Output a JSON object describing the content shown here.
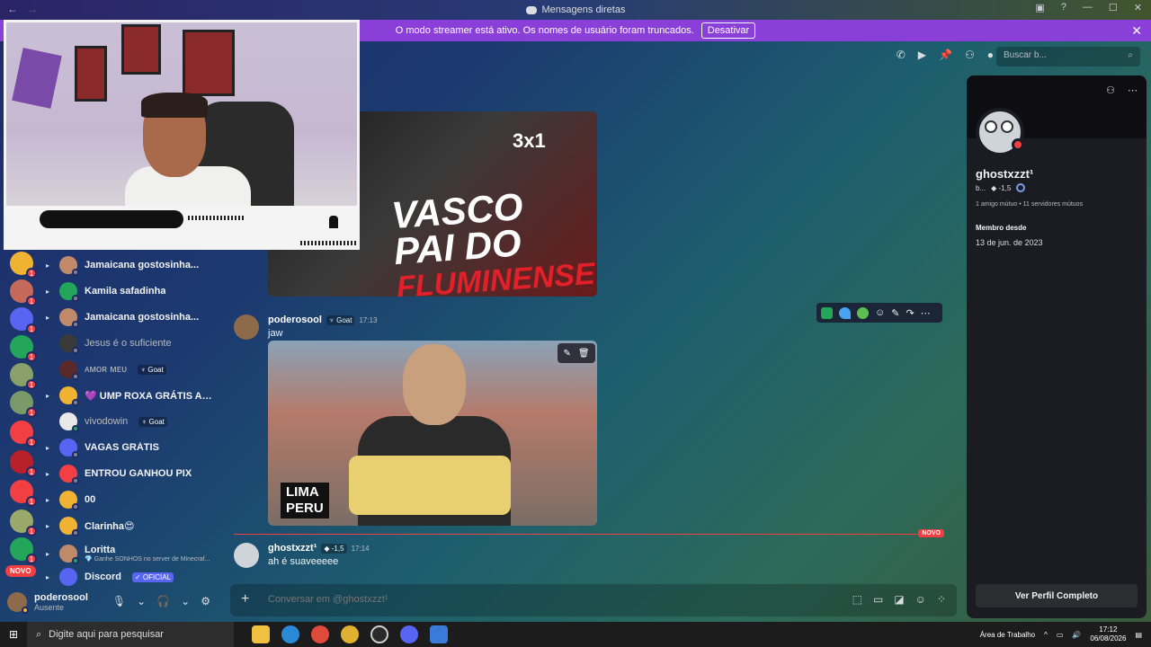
{
  "window": {
    "title": "Mensagens diretas",
    "nav_back": "←",
    "nav_forward": "→"
  },
  "banner": {
    "text": "O modo streamer está ativo. Os nomes de usuário foram truncados.",
    "button": "Desativar"
  },
  "rail": {
    "novo_label": "NOVO"
  },
  "dms": [
    {
      "name": "Jamaicana gostosinha...",
      "color": "#c08a6a"
    },
    {
      "name": "Kamila safadinha",
      "color": "#23a55a"
    },
    {
      "name": "Jamaicana gostosinha...",
      "color": "#c08a6a"
    },
    {
      "name": "Jesus é o suficiente",
      "color": "#3a3a3a",
      "muted": true
    },
    {
      "name": "ᴀᴍᴏʀ ᴍᴇᴜ",
      "tag": "Goat",
      "color": "#5a2a2a",
      "muted": true
    },
    {
      "name": "💜 UMP ROXA GRÁTIS AQUI",
      "color": "#f0b232"
    },
    {
      "name": "vivodowin",
      "tag": "Goat",
      "color": "#e8e8e8",
      "muted": true
    },
    {
      "name": "VAGAS GRÁTIS",
      "color": "#5865f2"
    },
    {
      "name": "ENTROU GANHOU PIX",
      "color": "#f23f43"
    },
    {
      "name": "00",
      "color": "#f0b232"
    },
    {
      "name": "Clarinha😍",
      "color": "#f0b232"
    },
    {
      "name": "Loritta",
      "sub": "💎 Ganhe SONHOS no server de Minecraf...",
      "color": "#c08a6a"
    },
    {
      "name": "Discord",
      "badge": "✓ OFICIAL",
      "color": "#5865f2"
    }
  ],
  "user": {
    "name": "poderosool",
    "status": "Ausente"
  },
  "header": {
    "search_placeholder": "Buscar b..."
  },
  "thumb1": {
    "line1": "VASCO",
    "line2": "PAI DO",
    "line3": "FLUMINENSE!",
    "score": "3x1"
  },
  "messages": [
    {
      "author": "poderosool",
      "badge": "Goat",
      "time": "17:13",
      "text": "jaw"
    },
    {
      "author": "ghostxzzt¹",
      "badge": "-1,5",
      "time": "17:14",
      "text": "ah é suaveeeee"
    }
  ],
  "thumb2": {
    "line1": "LIMA",
    "line2": "PERU"
  },
  "new_divider": "NOVO",
  "composer": {
    "placeholder": "Conversar em @ghostxzzt¹"
  },
  "profile": {
    "name": "ghostxzzt¹",
    "initial": "b...",
    "badge": "-1,5",
    "mutual_friends": "1 amigo mútuo",
    "mutual_servers": "11 servidores mútuos",
    "member_since_label": "Membro desde",
    "member_since": "13 de jun. de 2023",
    "view_full": "Ver Perfil Completo"
  },
  "taskbar": {
    "search": "Digite aqui para pesquisar",
    "desktop": "Área de Trabalho",
    "time": "17:12",
    "date": "06/08/2026"
  },
  "colors": {
    "banner": "#8b3fd9",
    "dnd": "#f23f43",
    "online": "#23a55a",
    "blurple": "#5865f2"
  }
}
